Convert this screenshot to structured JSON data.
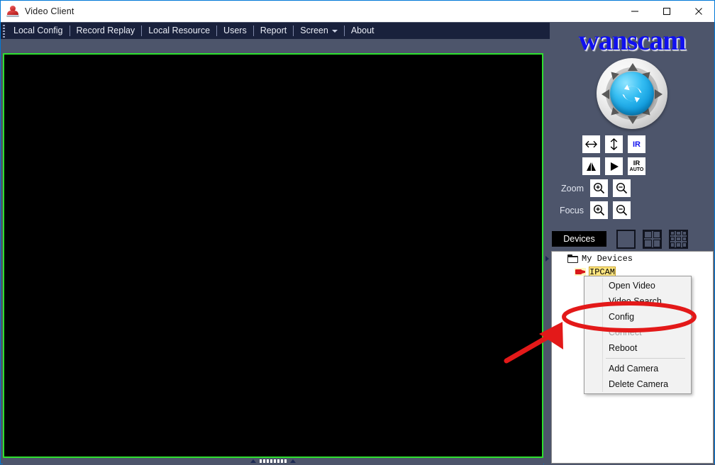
{
  "window": {
    "title": "Video Client",
    "icon": "app-icon",
    "controls": {
      "minimize": "minimize-icon",
      "maximize": "maximize-icon",
      "close": "close-icon"
    }
  },
  "menubar": {
    "grip": "drag-grip",
    "items": [
      {
        "label": "Local Config",
        "has_caret": false
      },
      {
        "label": "Record Replay",
        "has_caret": false
      },
      {
        "label": "Local Resource",
        "has_caret": false
      },
      {
        "label": "Users",
        "has_caret": false
      },
      {
        "label": "Report",
        "has_caret": false
      },
      {
        "label": "Screen",
        "has_caret": true
      },
      {
        "label": "About",
        "has_caret": false
      }
    ]
  },
  "video": {
    "state": "black",
    "border_color": "#2ee02e"
  },
  "brand": {
    "text": "wanscam",
    "color": "#1111ee"
  },
  "ptz": {
    "name": "ptz-dpad",
    "center_icon": "refresh-rotate-icon",
    "directions": [
      "up",
      "up-right",
      "right",
      "down-right",
      "down",
      "down-left",
      "left",
      "up-left"
    ]
  },
  "controls": {
    "rows": [
      {
        "label": "",
        "buttons": [
          {
            "name": "horizontal-patrol-button",
            "icon": "left-right-arrow-icon"
          },
          {
            "name": "vertical-patrol-button",
            "icon": "up-down-arrow-icon"
          },
          {
            "name": "ir-button",
            "icon": "ir-text-icon",
            "text": "IR"
          }
        ]
      },
      {
        "label": "",
        "buttons": [
          {
            "name": "horizontal-mirror-button",
            "icon": "mirror-flip-icon"
          },
          {
            "name": "vertical-flip-button",
            "icon": "play-triangle-icon"
          },
          {
            "name": "ir-auto-button",
            "icon": "ir-auto-text-icon",
            "text": "IR",
            "subtext": "AUTO"
          }
        ]
      },
      {
        "label": "Zoom",
        "buttons": [
          {
            "name": "zoom-in-button",
            "icon": "magnifier-plus-icon"
          },
          {
            "name": "zoom-out-button",
            "icon": "magnifier-minus-icon"
          }
        ]
      },
      {
        "label": "Focus",
        "buttons": [
          {
            "name": "focus-in-button",
            "icon": "magnifier-plus-icon"
          },
          {
            "name": "focus-out-button",
            "icon": "magnifier-minus-icon"
          }
        ]
      }
    ]
  },
  "devices_bar": {
    "tab_label": "Devices",
    "layouts": [
      {
        "name": "layout-1x1-button",
        "cells": 1
      },
      {
        "name": "layout-2x2-button",
        "cells": 4
      },
      {
        "name": "layout-3x3-button",
        "cells": 9
      }
    ]
  },
  "device_tree": {
    "root": {
      "label": "My Devices",
      "icon": "folder-icon"
    },
    "children": [
      {
        "label": "IPCAM",
        "icon": "camera-icon",
        "selected": true
      }
    ]
  },
  "context_menu": {
    "items": [
      {
        "label": "Open Video",
        "disabled": false,
        "separator_after": false
      },
      {
        "label": "Video Search",
        "disabled": false,
        "separator_after": false
      },
      {
        "label": "Config",
        "disabled": false,
        "separator_after": false,
        "highlighted": true
      },
      {
        "label": "Connect",
        "disabled": true,
        "separator_after": false
      },
      {
        "label": "Reboot",
        "disabled": false,
        "separator_after": true
      },
      {
        "label": "Add Camera",
        "disabled": false,
        "separator_after": false
      },
      {
        "label": "Delete Camera",
        "disabled": false,
        "separator_after": false
      }
    ]
  },
  "annotations": {
    "ellipse": {
      "name": "config-highlight-ellipse",
      "color": "#e31919"
    },
    "arrow": {
      "name": "pointer-arrow",
      "color": "#e31919"
    }
  },
  "splitters": {
    "horizontal": "horizontal-splitter",
    "vertical": "vertical-splitter"
  }
}
